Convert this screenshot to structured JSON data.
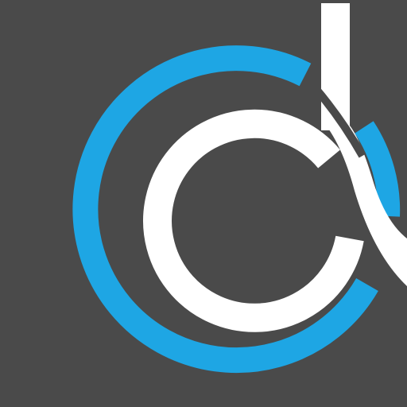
{
  "logo": {
    "name": "d-alpha-monogram",
    "colors": {
      "background": "#4a4a4a",
      "outer_ring": "#1ea6e4",
      "inner_mark": "#ffffff"
    }
  }
}
